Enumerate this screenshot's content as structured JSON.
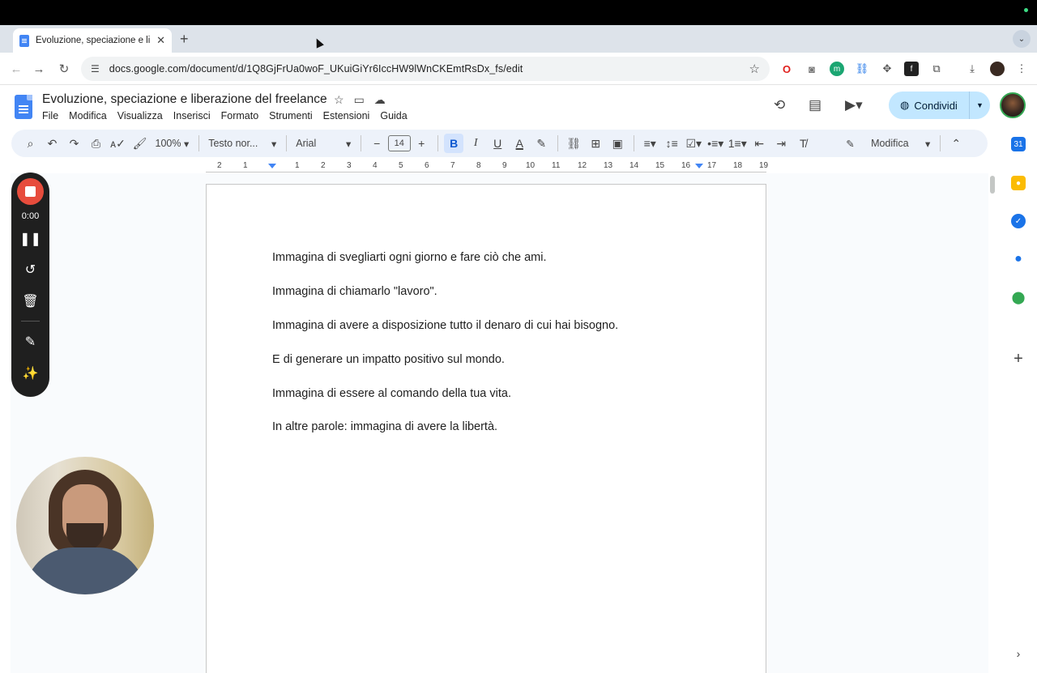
{
  "browser": {
    "tab_title": "Evoluzione, speciazione e libe",
    "tab_close": "✕",
    "new_tab": "+",
    "tab_menu": "⌄",
    "url": "docs.google.com/document/d/1Q8GjFrUa0woF_UKuiGiYr6IccHW9lWnCKEmtRsDx_fs/edit"
  },
  "docs": {
    "title": "Evoluzione, speciazione e liberazione del freelance",
    "menu": [
      "File",
      "Modifica",
      "Visualizza",
      "Inserisci",
      "Formato",
      "Strumenti",
      "Estensioni",
      "Guida"
    ],
    "share_label": "Condividi",
    "toolbar": {
      "zoom": "100%",
      "style": "Testo nor...",
      "font": "Arial",
      "font_size": "14",
      "mode": "Modifica"
    },
    "ruler": [
      "2",
      "1",
      "1",
      "2",
      "3",
      "4",
      "5",
      "6",
      "7",
      "8",
      "9",
      "10",
      "11",
      "12",
      "13",
      "14",
      "15",
      "16",
      "17",
      "18",
      "19"
    ],
    "paragraphs": [
      "Immagina di svegliarti ogni giorno e fare ciò che ami.",
      "Immagina di chiamarlo \"lavoro\".",
      "Immagina di avere a disposizione tutto il denaro di cui hai bisogno.",
      "E di generare un impatto positivo sul mondo.",
      "Immagina di essere al comando della tua vita.",
      "In altre parole: immagina di avere la libertà."
    ]
  },
  "recorder": {
    "time": "0:00"
  },
  "colors": {
    "accent": "#0b57d0",
    "share_bg": "#c2e7ff",
    "record_red": "#e74c3c",
    "toolbar_bg": "#edf2fa"
  }
}
